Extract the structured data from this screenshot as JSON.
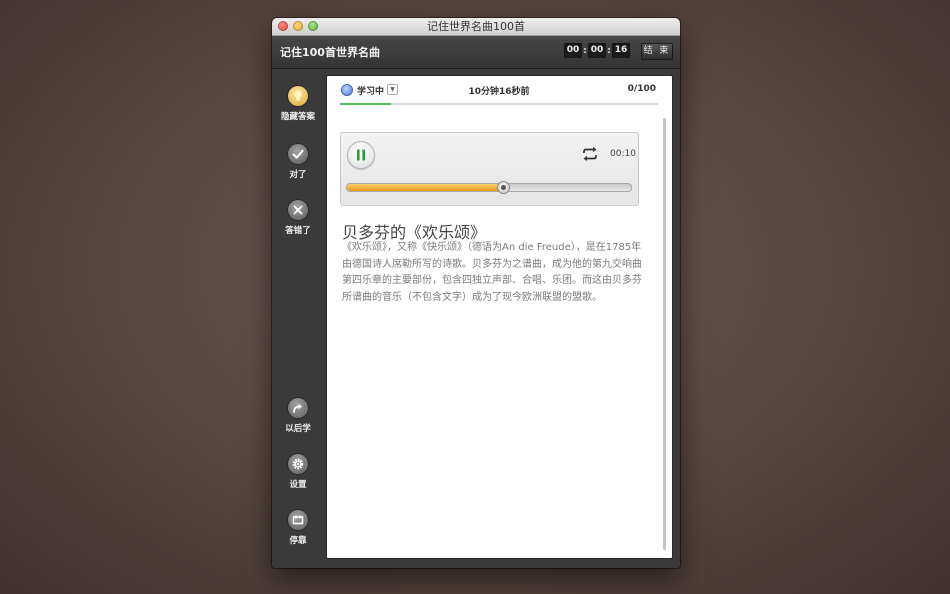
{
  "window": {
    "title": "记住世界名曲100首"
  },
  "header": {
    "app_title": "记住100首世界名曲",
    "timer": {
      "hours": "00",
      "minutes": "00",
      "seconds": "16"
    },
    "end_label": "结 束"
  },
  "sidebar": {
    "items": [
      {
        "label": "隐藏答案",
        "icon": "lightbulb-icon"
      },
      {
        "label": "对了",
        "icon": "check-icon"
      },
      {
        "label": "答错了",
        "icon": "x-icon"
      },
      {
        "label": "以后学",
        "icon": "forward-arrow-icon"
      },
      {
        "label": "设置",
        "icon": "gear-icon"
      },
      {
        "label": "停靠",
        "icon": "dock-icon"
      }
    ]
  },
  "status": {
    "label": "学习中",
    "elapsed": "10分钟16秒前",
    "progress": "0/100",
    "progress_fraction": 0.16
  },
  "player": {
    "time": "00:10",
    "position_fraction": 0.55,
    "accent": "#e79a18"
  },
  "content": {
    "title": "贝多芬的《欢乐颂》",
    "description": "《欢乐颂》，又称《快乐颂》（德语为An die Freude），是在1785年由德国诗人席勒所写的诗歌。贝多芬为之谱曲，成为他的第九交响曲第四乐章的主要部份，包含四独立声部、合唱、乐团。而这由贝多芬所谱曲的音乐（不包含文字）成为了现今欧洲联盟的盟歌。"
  }
}
